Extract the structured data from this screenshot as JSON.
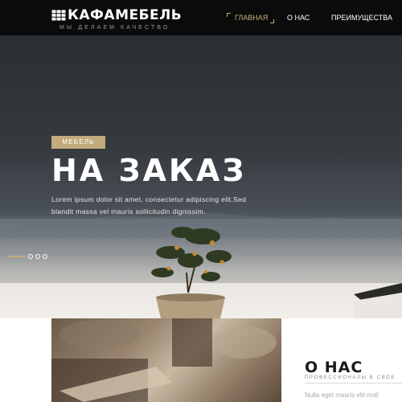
{
  "header": {
    "logo_text": "КАФАМЕБЕЛЬ",
    "tagline": "МЫ ДЕЛАЕМ КАЧЕСТВО",
    "nav": [
      {
        "label": "ГЛАВНАЯ",
        "active": true
      },
      {
        "label": "О НАС",
        "active": false
      },
      {
        "label": "ПРЕИМУЩЕСТВА",
        "active": false
      }
    ]
  },
  "hero": {
    "badge": "МЕБЕЛЬ",
    "title": "НА ЗАКАЗ",
    "description": "Lorem ipsum dolor sit amet, consectetur adipiscing elit.Sed blandit massa vel mauris sollicitudin dignissim.",
    "slider": {
      "total": 4,
      "active": 1
    }
  },
  "about": {
    "title": "О НАС",
    "subtitle": "ПРОФЕССИОНАЛЫ В СВОЕ",
    "text": "Nulla eget mauris elit moll"
  },
  "colors": {
    "accent": "#c2aa7d",
    "header_bg": "#0b0b0b",
    "hero_bg": "#2b2f33"
  }
}
